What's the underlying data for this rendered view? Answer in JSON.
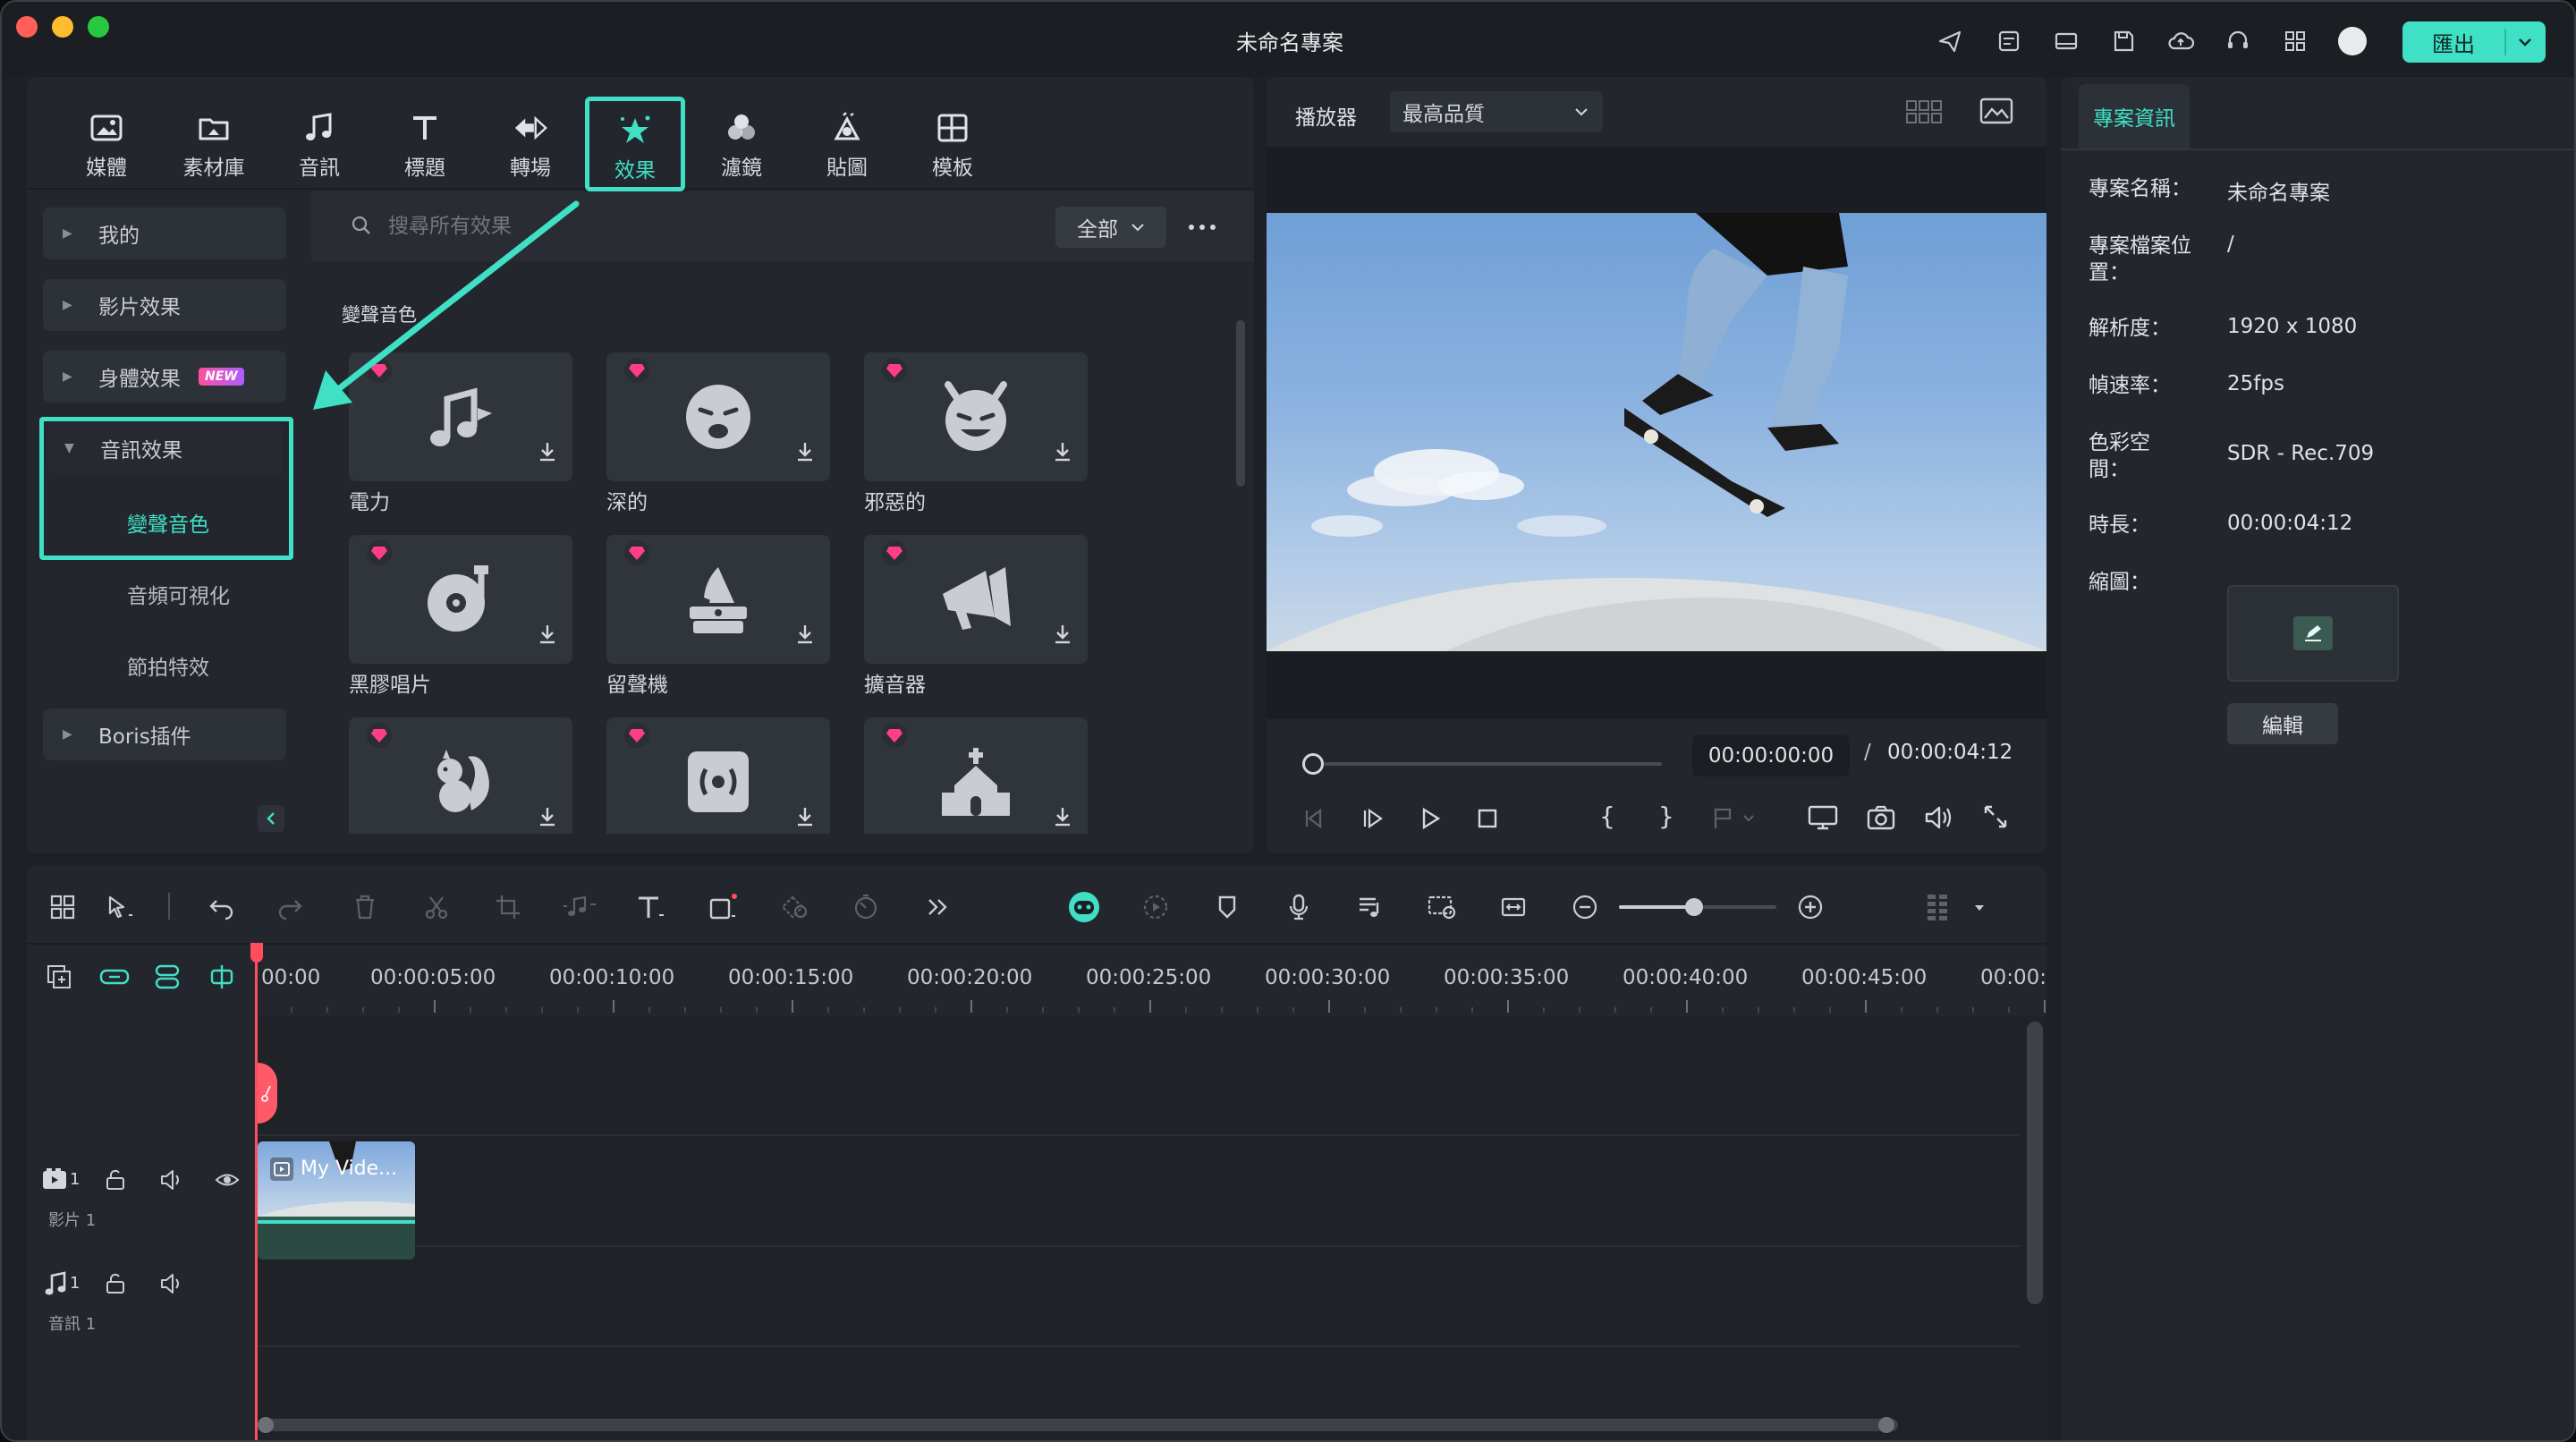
{
  "window": {
    "title": "未命名專案"
  },
  "toolbar_right": {
    "export_label": "匯出"
  },
  "tabs": [
    {
      "label": "媒體",
      "icon": "media-icon"
    },
    {
      "label": "素材庫",
      "icon": "stock-library-icon"
    },
    {
      "label": "音訊",
      "icon": "audio-note-icon"
    },
    {
      "label": "標題",
      "icon": "title-t-icon"
    },
    {
      "label": "轉場",
      "icon": "transition-icon"
    },
    {
      "label": "效果",
      "icon": "effects-star-icon",
      "active": true
    },
    {
      "label": "濾鏡",
      "icon": "filters-icon"
    },
    {
      "label": "貼圖",
      "icon": "stickers-icon"
    },
    {
      "label": "模板",
      "icon": "templates-icon"
    }
  ],
  "sidebar": {
    "items": [
      {
        "label": "我的"
      },
      {
        "label": "影片效果"
      },
      {
        "label": "身體效果",
        "badge": "NEW"
      },
      {
        "label": "音訊效果",
        "expanded": true
      },
      {
        "label": "Boris插件"
      }
    ],
    "sub_items": [
      "變聲音色",
      "音頻可視化",
      "節拍特效"
    ]
  },
  "search": {
    "placeholder": "搜尋所有效果",
    "filter": "全部"
  },
  "effects": {
    "section_title": "變聲音色",
    "cards": [
      {
        "label": "電力",
        "icon": "music-notes-icon"
      },
      {
        "label": "深的",
        "icon": "tired-face-icon"
      },
      {
        "label": "邪惡的",
        "icon": "devil-face-icon"
      },
      {
        "label": "黑膠唱片",
        "icon": "vinyl-record-icon"
      },
      {
        "label": "留聲機",
        "icon": "gramophone-icon"
      },
      {
        "label": "擴音器",
        "icon": "megaphone-icon"
      },
      {
        "label": "",
        "icon": "squirrel-icon"
      },
      {
        "label": "",
        "icon": "radio-signal-icon"
      },
      {
        "label": "",
        "icon": "church-icon"
      }
    ]
  },
  "player": {
    "label": "播放器",
    "quality": "最高品質",
    "current_time": "00:00:00:00",
    "separator": "/",
    "total_time": "00:00:04:12"
  },
  "project_info": {
    "tab": "專案資訊",
    "rows": [
      {
        "label": "專案名稱：",
        "value": "未命名專案"
      },
      {
        "label": "專案檔案位置：",
        "value": "/"
      },
      {
        "label": "解析度：",
        "value": "1920 x 1080"
      },
      {
        "label": "幀速率：",
        "value": "25fps"
      },
      {
        "label": "色彩空間：",
        "value": "SDR - Rec.709"
      },
      {
        "label": "時長：",
        "value": "00:00:04:12"
      },
      {
        "label": "縮圖：",
        "value": ""
      }
    ],
    "edit_button": "編輯"
  },
  "timeline": {
    "ticks": [
      "00:00",
      "00:00:05:00",
      "00:00:10:00",
      "00:00:15:00",
      "00:00:20:00",
      "00:00:25:00",
      "00:00:30:00",
      "00:00:35:00",
      "00:00:40:00",
      "00:00:45:00",
      "00:00:"
    ],
    "tracks": [
      {
        "number": "1",
        "name": "影片 1"
      },
      {
        "number": "1",
        "name": "音訊 1"
      }
    ],
    "clip_label": "My Vide..."
  },
  "colors": {
    "accent": "#3fe0c5",
    "playhead": "#ff4d5e",
    "gem": "#ff3d8b"
  }
}
